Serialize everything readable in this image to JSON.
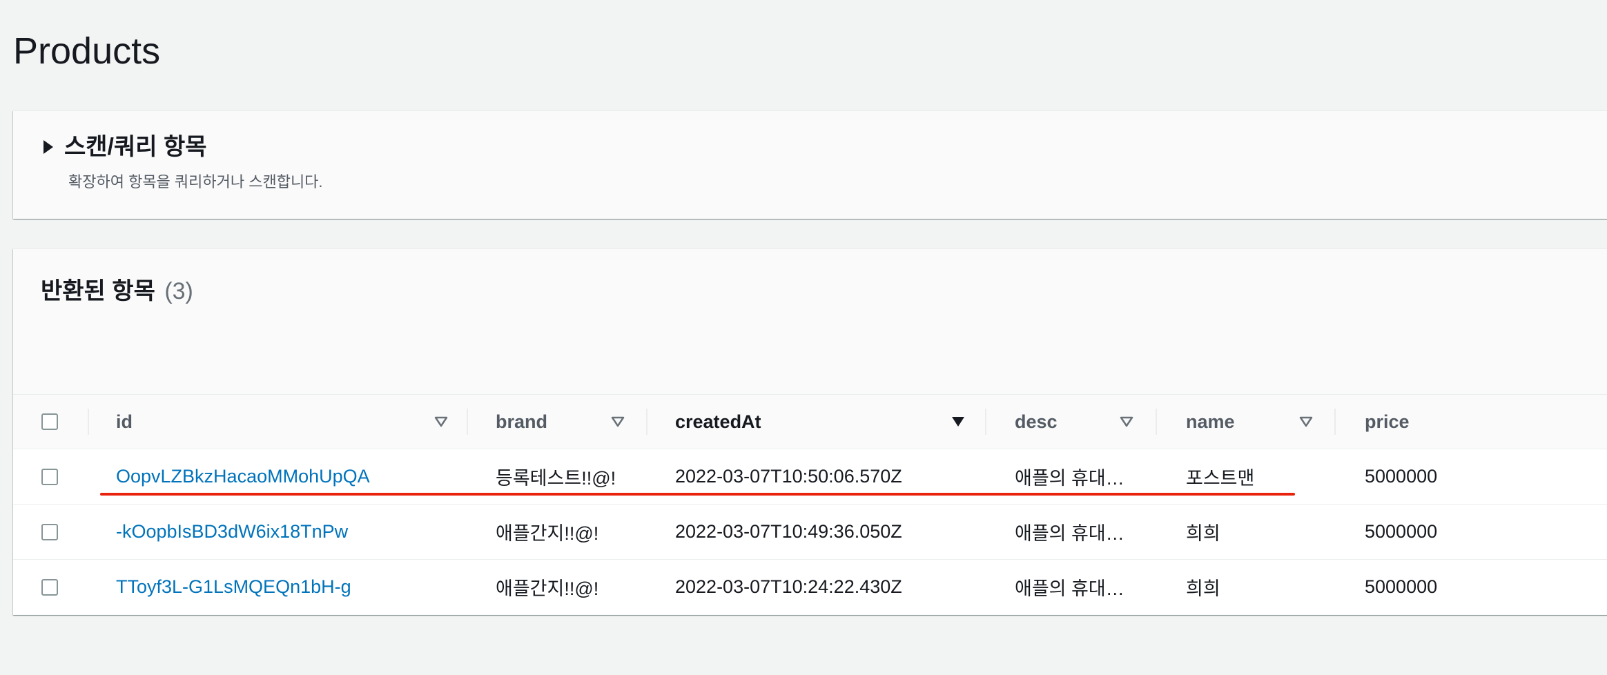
{
  "page": {
    "title": "Products"
  },
  "scan_panel": {
    "title": "스캔/쿼리 항목",
    "description": "확장하여 항목을 쿼리하거나 스캔합니다."
  },
  "results": {
    "title": "반환된 항목",
    "count": "(3)",
    "columns": [
      {
        "label": "id",
        "sort": "unsorted"
      },
      {
        "label": "brand",
        "sort": "unsorted"
      },
      {
        "label": "createdAt",
        "sort": "descending"
      },
      {
        "label": "desc",
        "sort": "unsorted"
      },
      {
        "label": "name",
        "sort": "unsorted"
      },
      {
        "label": "price",
        "sort": "none"
      }
    ],
    "rows": [
      {
        "id": "OopvLZBkzHacaoMMohUpQA",
        "brand": "등록테스트!!@!",
        "createdAt": "2022-03-07T10:50:06.570Z",
        "desc": "애플의 휴대…",
        "name": "포스트맨",
        "price": "5000000"
      },
      {
        "id": "-kOopbIsBD3dW6ix18TnPw",
        "brand": "애플간지!!@!",
        "createdAt": "2022-03-07T10:49:36.050Z",
        "desc": "애플의 휴대…",
        "name": "희희",
        "price": "5000000"
      },
      {
        "id": "TToyf3L-G1LsMQEQn1bH-g",
        "brand": "애플간지!!@!",
        "createdAt": "2022-03-07T10:24:22.430Z",
        "desc": "애플의 휴대…",
        "name": "희희",
        "price": "5000000"
      }
    ]
  },
  "colors": {
    "link": "#0073bb",
    "annotation_underline": "#e8220c",
    "background": "#f2f3f3"
  }
}
